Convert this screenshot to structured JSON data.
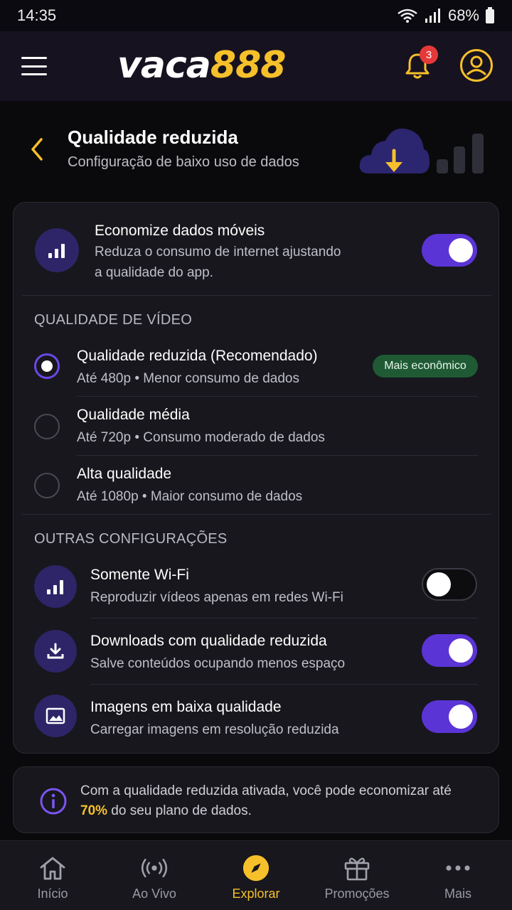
{
  "status_bar": {
    "time": "14:35",
    "battery": "68%"
  },
  "header": {
    "logo_white": "vaca",
    "logo_yellow": "888",
    "notification_count": "3"
  },
  "page": {
    "title": "Qualidade reduzida",
    "subtitle": "Configuração de baixo uso de dados"
  },
  "save_data": {
    "title": "Economize dados móveis",
    "desc_line1": "Reduza o consumo de internet ajustando",
    "desc_line2": "a qualidade do app.",
    "enabled": true
  },
  "video_quality": {
    "section_label": "QUALIDADE DE VÍDEO",
    "options": [
      {
        "title": "Qualidade reduzida (Recomendado)",
        "desc": "Até 480p • Menor consumo de dados",
        "selected": true,
        "badge": "Mais econômico"
      },
      {
        "title": "Qualidade média",
        "desc": "Até 720p • Consumo moderado de dados",
        "selected": false
      },
      {
        "title": "Alta qualidade",
        "desc": "Até 1080p • Maior  consumo de dados",
        "selected": false
      }
    ]
  },
  "other_settings": {
    "section_label": "OUTRAS CONFIGURAÇÕES",
    "items": [
      {
        "icon": "signal-bars-icon",
        "title": "Somente Wi-Fi",
        "desc": "Reproduzir vídeos apenas em redes Wi-Fi",
        "enabled": false
      },
      {
        "icon": "download-icon",
        "title": "Downloads com qualidade reduzida",
        "desc": "Salve conteúdos ocupando menos espaço",
        "enabled": true
      },
      {
        "icon": "image-icon",
        "title": "Imagens em baixa qualidade",
        "desc": "Carregar imagens em resolução reduzida",
        "enabled": true
      }
    ]
  },
  "info": {
    "text_before": "Com a qualidade reduzida ativada, você pode economizar até ",
    "highlight": "70%",
    "text_after": " do seu plano de dados."
  },
  "bottom_nav": [
    {
      "label": "Início",
      "icon": "home-icon",
      "active": false
    },
    {
      "label": "Ao Vivo",
      "icon": "live-broadcast-icon",
      "active": false
    },
    {
      "label": "Explorar",
      "icon": "compass-icon",
      "active": true
    },
    {
      "label": "Promoções",
      "icon": "gift-icon",
      "active": false
    },
    {
      "label": "Mais",
      "icon": "more-dots-icon",
      "active": false
    }
  ],
  "colors": {
    "accent": "#5b34d6",
    "brand_yellow": "#f6c02b",
    "eco_badge": "#1f5a35"
  }
}
